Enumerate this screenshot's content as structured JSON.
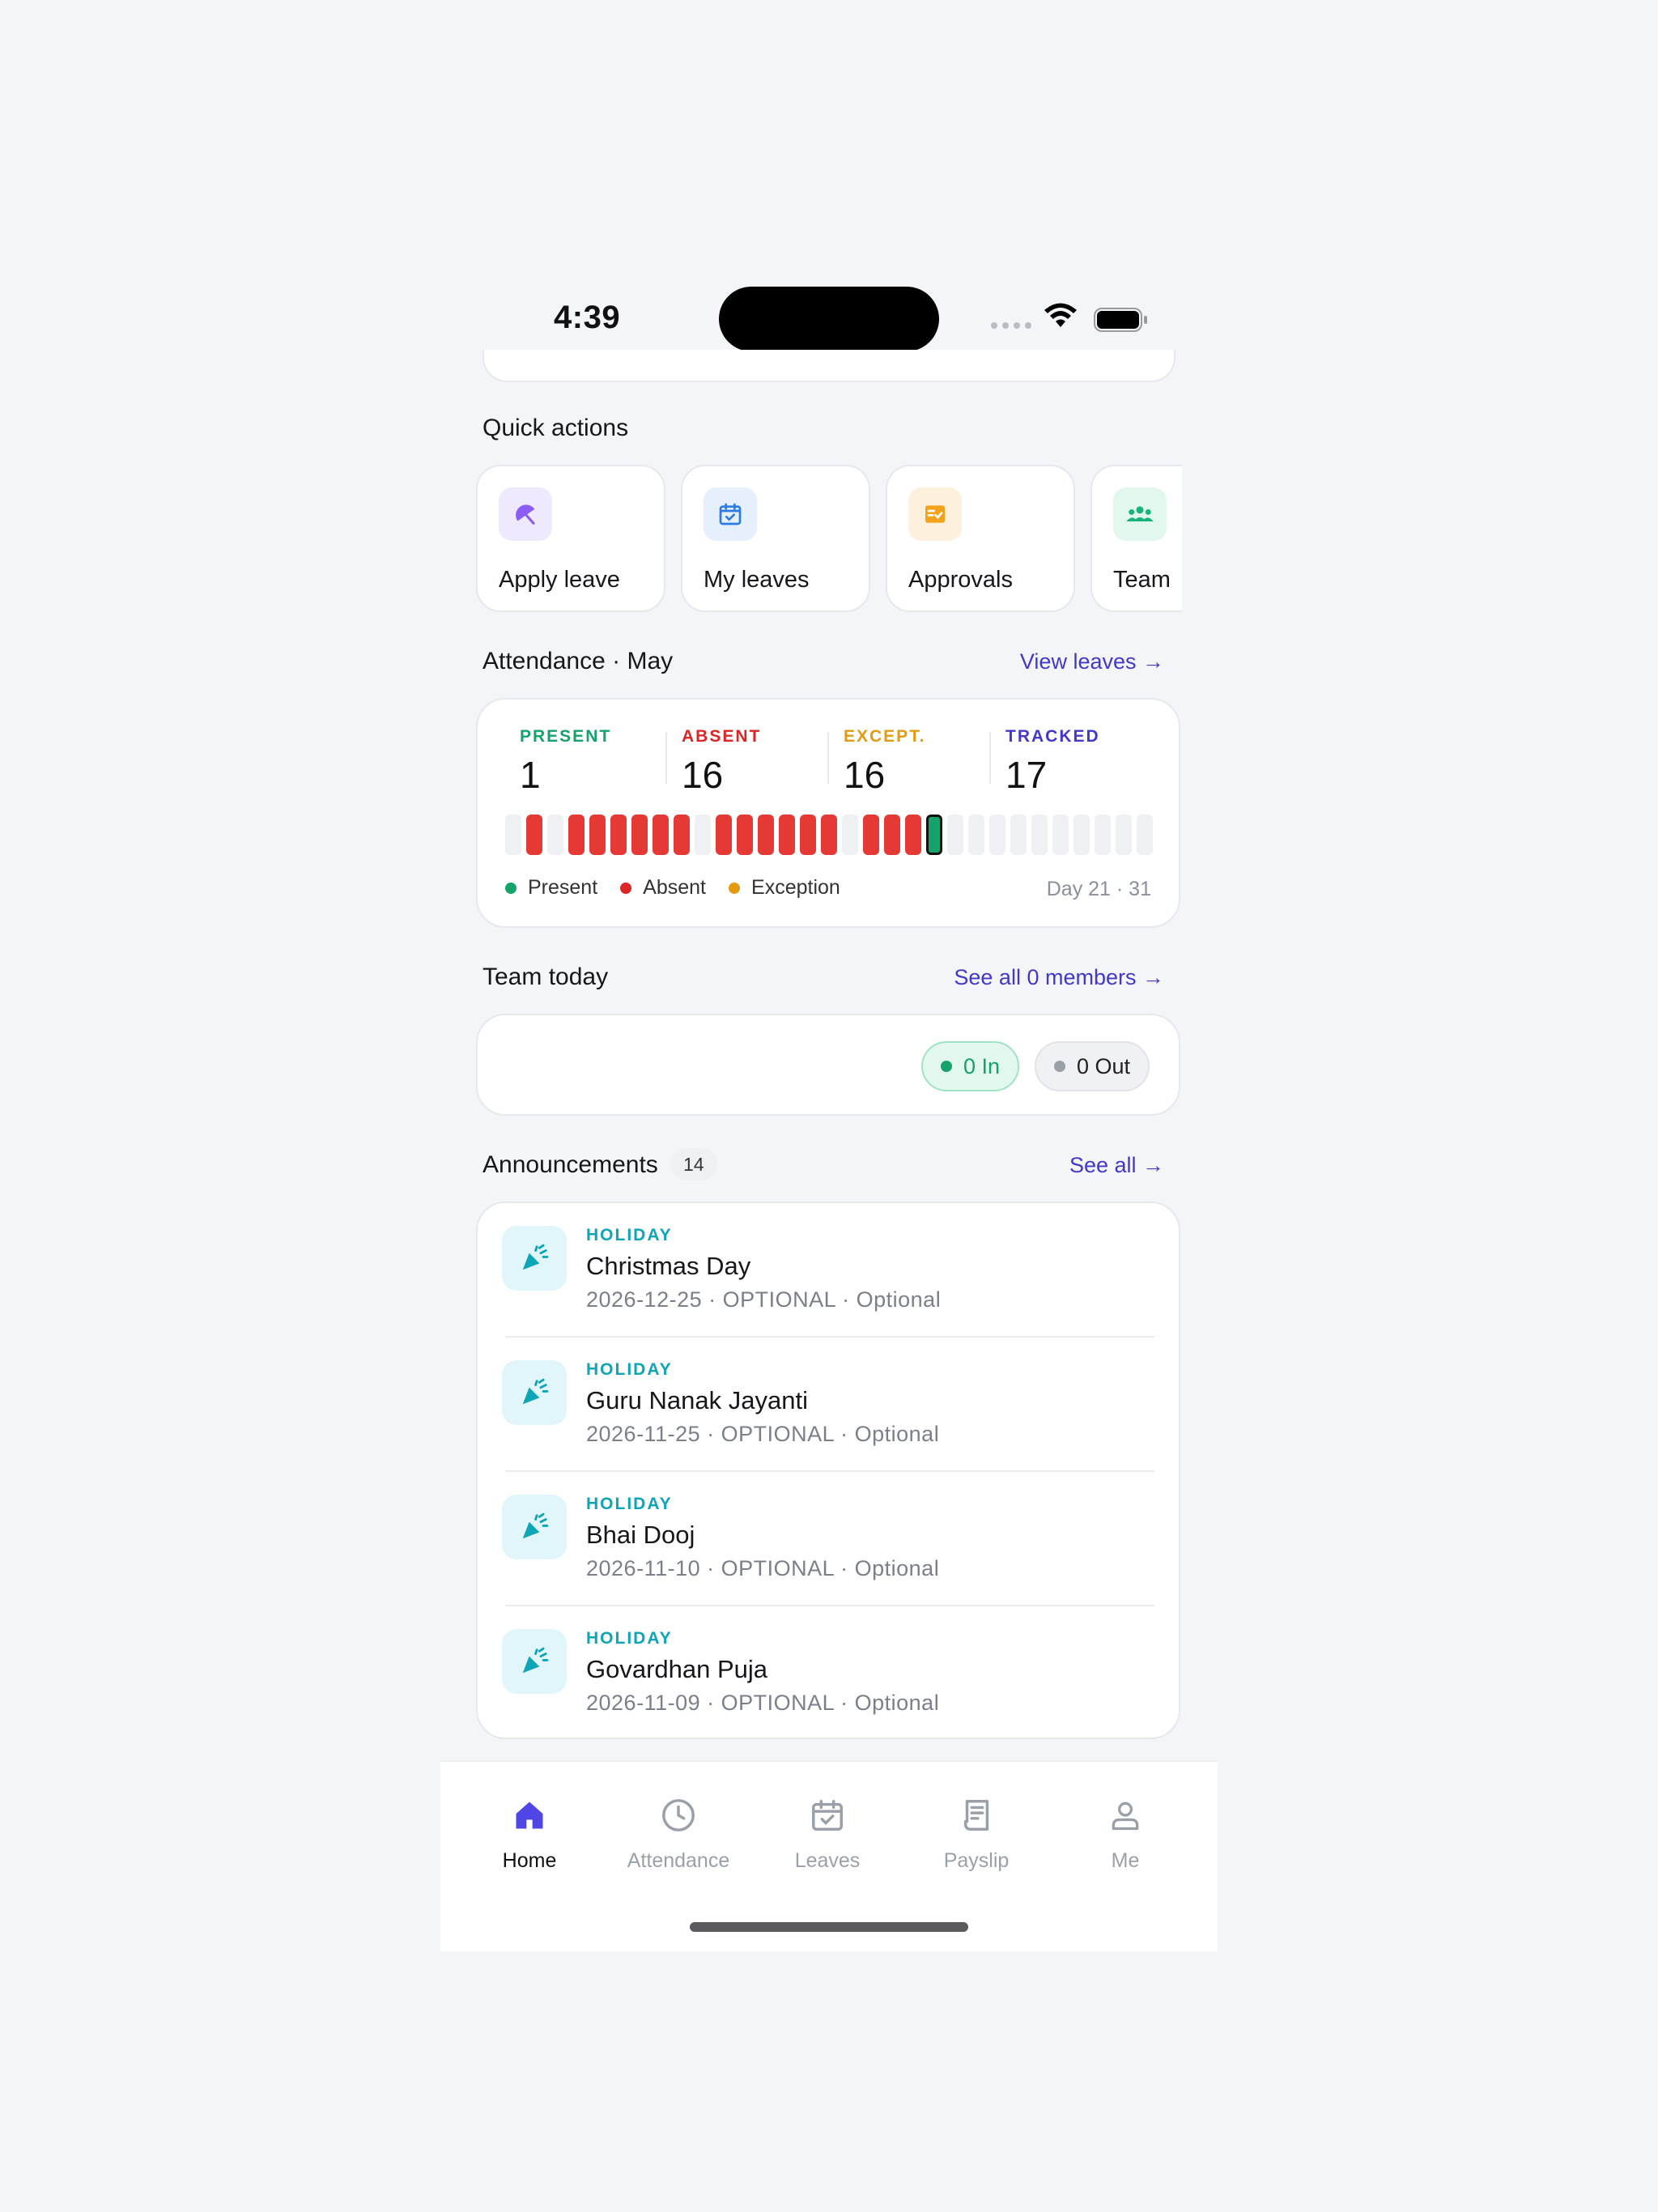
{
  "status_bar": {
    "time": "4:39"
  },
  "quick_actions": {
    "title": "Quick actions",
    "items": [
      {
        "label": "Apply leave",
        "icon": "umbrella-icon",
        "color": "#8b5cf6",
        "bg": "#efe9fd"
      },
      {
        "label": "My leaves",
        "icon": "calendar-check-icon",
        "color": "#2b7be4",
        "bg": "#e6f0fc"
      },
      {
        "label": "Approvals",
        "icon": "checklist-icon",
        "color": "#f2a31b",
        "bg": "#fdf1de"
      },
      {
        "label": "Team",
        "icon": "group-icon",
        "color": "#16b37a",
        "bg": "#e2f7ee"
      }
    ]
  },
  "attendance": {
    "title": "Attendance · May",
    "view_link": "View leaves →",
    "stats": [
      {
        "key": "PRESENT",
        "value": "1",
        "color": "#16a36b"
      },
      {
        "key": "ABSENT",
        "value": "16",
        "color": "#dc2626"
      },
      {
        "key": "EXCEPT.",
        "value": "16",
        "color": "#e29b12"
      },
      {
        "key": "TRACKED",
        "value": "17",
        "color": "#4338ca"
      }
    ],
    "days": [
      "empty",
      "absent",
      "empty",
      "absent",
      "absent",
      "absent",
      "absent",
      "absent",
      "absent",
      "empty",
      "absent",
      "absent",
      "absent",
      "absent",
      "absent",
      "absent",
      "empty",
      "absent",
      "absent",
      "absent",
      "today",
      "empty",
      "empty",
      "empty",
      "empty",
      "empty",
      "empty",
      "empty",
      "empty",
      "empty",
      "empty"
    ],
    "legend": [
      {
        "label": "Present",
        "color": "#16a36b"
      },
      {
        "label": "Absent",
        "color": "#dc2626"
      },
      {
        "label": "Exception",
        "color": "#e29b12"
      }
    ],
    "day_info": "Day 21 · 31",
    "colors": {
      "absent": "#e53935",
      "empty": "#eef0f4",
      "today": "#16a36b"
    }
  },
  "team_today": {
    "title": "Team today",
    "see_all": "See all 0 members →",
    "in_label": "0 In",
    "out_label": "0 Out"
  },
  "announcements": {
    "title": "Announcements",
    "count": "14",
    "see_all": "See all →",
    "items": [
      {
        "category": "HOLIDAY",
        "title": "Christmas Day",
        "sub": "2026-12-25 · OPTIONAL · Optional"
      },
      {
        "category": "HOLIDAY",
        "title": "Guru Nanak Jayanti",
        "sub": "2026-11-25 · OPTIONAL · Optional"
      },
      {
        "category": "HOLIDAY",
        "title": "Bhai Dooj",
        "sub": "2026-11-10 · OPTIONAL · Optional"
      },
      {
        "category": "HOLIDAY",
        "title": "Govardhan Puja",
        "sub": "2026-11-09 · OPTIONAL · Optional"
      }
    ]
  },
  "tabbar": {
    "items": [
      {
        "label": "Home",
        "icon": "home-icon",
        "active": true
      },
      {
        "label": "Attendance",
        "icon": "clock-icon",
        "active": false
      },
      {
        "label": "Leaves",
        "icon": "calendar-check-icon",
        "active": false
      },
      {
        "label": "Payslip",
        "icon": "receipt-icon",
        "active": false
      },
      {
        "label": "Me",
        "icon": "user-icon",
        "active": false
      }
    ]
  }
}
